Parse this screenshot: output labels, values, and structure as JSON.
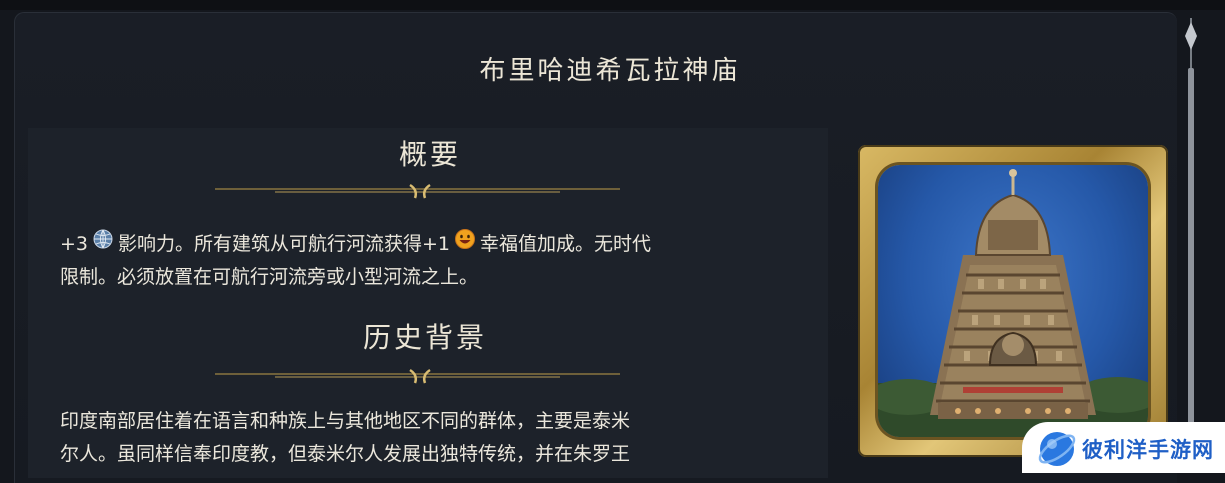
{
  "title": "布里哈迪希瓦拉神庙",
  "overview": {
    "heading": "概要",
    "line1_a": "+3",
    "line1_b": "影响力。所有建筑从可航行河流获得+1",
    "line1_c": "幸福值加成。无时代",
    "line2": "限制。必须放置在可航行河流旁或小型河流之上。"
  },
  "history": {
    "heading": "历史背景",
    "line1": "印度南部居住着在语言和种族上与其他地区不同的群体，主要是泰米",
    "line2": "尔人。虽同样信奉印度教，但泰米尔人发展出独特传统，并在朱罗王"
  },
  "icons": {
    "influence": "globe-icon",
    "happiness": "smiley-icon"
  },
  "colors": {
    "accent_gold": "#c9a85a",
    "sky_blue": "#2a5fb0"
  },
  "watermark": {
    "text": "彼利洋手游网"
  }
}
